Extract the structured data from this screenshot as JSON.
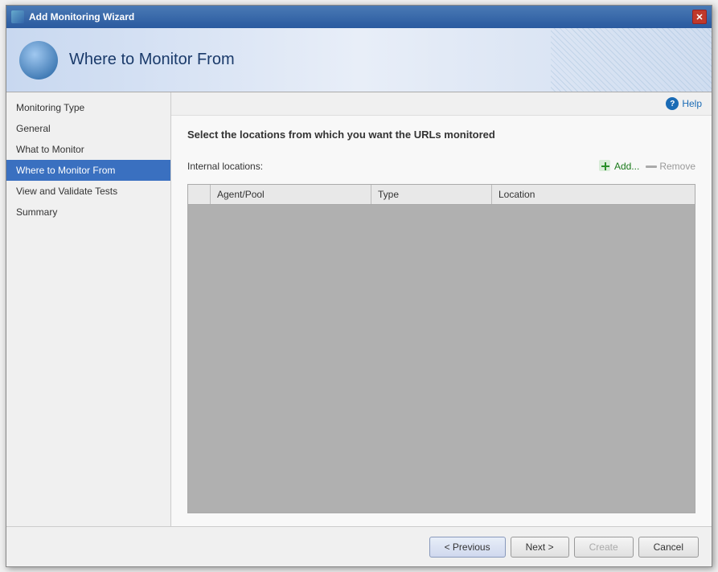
{
  "window": {
    "title": "Add Monitoring Wizard",
    "close_label": "✕"
  },
  "header": {
    "title": "Where to Monitor From"
  },
  "help": {
    "label": "Help",
    "icon_text": "?"
  },
  "sidebar": {
    "items": [
      {
        "id": "monitoring-type",
        "label": "Monitoring Type",
        "active": false
      },
      {
        "id": "general",
        "label": "General",
        "active": false
      },
      {
        "id": "what-to-monitor",
        "label": "What to Monitor",
        "active": false
      },
      {
        "id": "where-to-monitor",
        "label": "Where to Monitor From",
        "active": true
      },
      {
        "id": "view-validate",
        "label": "View and Validate Tests",
        "active": false
      },
      {
        "id": "summary",
        "label": "Summary",
        "active": false
      }
    ]
  },
  "content": {
    "instruction": "Select the locations from which you want the URLs monitored",
    "internal_locations_label": "Internal locations:",
    "add_label": "Add...",
    "remove_label": "Remove",
    "table": {
      "columns": [
        {
          "id": "check",
          "label": ""
        },
        {
          "id": "agent-pool",
          "label": "Agent/Pool"
        },
        {
          "id": "type",
          "label": "Type"
        },
        {
          "id": "location",
          "label": "Location"
        }
      ],
      "rows": []
    }
  },
  "footer": {
    "previous_label": "< Previous",
    "next_label": "Next >",
    "create_label": "Create",
    "cancel_label": "Cancel"
  }
}
